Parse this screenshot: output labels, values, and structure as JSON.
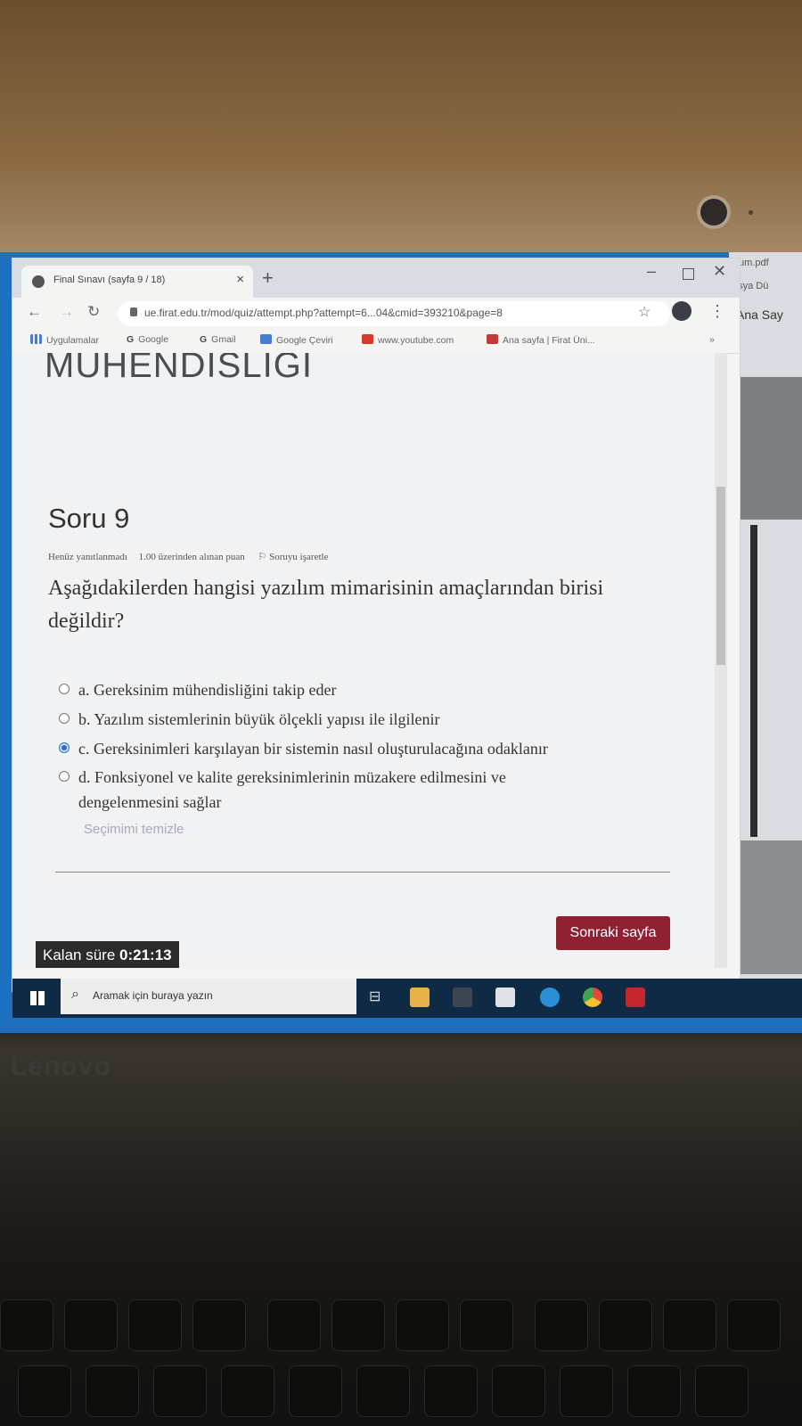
{
  "bezel": {
    "brand": "Lenovo"
  },
  "browser": {
    "tab_title": "Final Sınavı (sayfa 9 / 18)",
    "tab_close": "×",
    "new_tab": "+",
    "url": "ue.firat.edu.tr/mod/quiz/attempt.php?attempt=6...04&cmid=393210&page=8",
    "bookmarks": [
      "Uygulamalar",
      "Google",
      "Gmail",
      "Google Çeviri",
      "www.youtube.com",
      "Ana sayfa | Firat Üni..."
    ]
  },
  "page": {
    "headline": "MÜHENDİSLİĞİ",
    "question_number": "Soru 9",
    "status": "Henüz yanıtlanmadı",
    "points": "1.00 üzerinden alınan puan",
    "flag": "Soruyu işaretle",
    "question": "Aşağıdakilerden hangisi yazılım mimarisinin amaçlarından birisi değildir?",
    "options": [
      {
        "label": "a. Gereksinim mühendisliğini takip eder",
        "selected": false
      },
      {
        "label": "b. Yazılım sistemlerinin büyük ölçekli yapısı ile ilgilenir",
        "selected": false
      },
      {
        "label": "c. Gereksinimleri karşılayan bir sistemin nasıl oluşturulacağına odaklanır",
        "selected": true
      },
      {
        "label": "d. Fonksiyonel ve kalite gereksinimlerinin müzakere edilmesini ve",
        "label_line2": "dengelenmesini sağlar",
        "selected": false
      }
    ],
    "clear_choice": "Seçimimi temizle",
    "next_button": "Sonraki sayfa",
    "timer_label": "Kalan süre",
    "timer_value": "0:21:13"
  },
  "taskbar": {
    "search_placeholder": "Aramak için buraya yazın"
  },
  "side_window": {
    "title": "tum.pdf",
    "menu": "osya Dü",
    "tab": "Ana Say"
  },
  "colors": {
    "accent": "#8e2233",
    "taskbar": "#0f2a45",
    "selected_radio": "#2f6fd1"
  }
}
